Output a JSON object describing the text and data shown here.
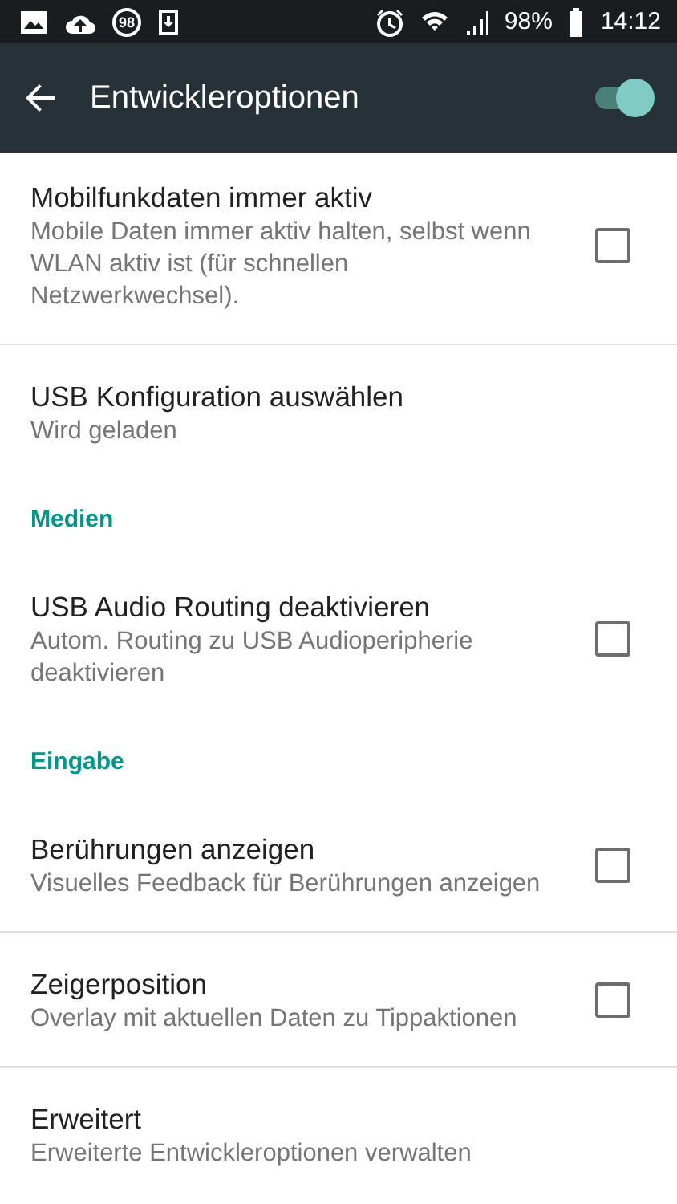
{
  "status_bar": {
    "badge": "98",
    "battery": "98%",
    "time": "14:12"
  },
  "toolbar": {
    "title": "Entwickleroptionen",
    "master_switch": {
      "on": true
    }
  },
  "items": [
    {
      "kind": "checkbox",
      "title": "Mobilfunkdaten immer aktiv",
      "summary": "Mobile Daten immer aktiv halten, selbst wenn WLAN aktiv ist (für schnellen Netzwerkwechsel).",
      "checked": false
    },
    {
      "kind": "plain",
      "title": "USB Konfiguration auswählen",
      "summary": "Wird geladen"
    },
    {
      "kind": "category",
      "title": "Medien"
    },
    {
      "kind": "checkbox",
      "title": "USB Audio Routing deaktivieren",
      "summary": "Autom. Routing zu USB Audioperipherie deaktivieren",
      "checked": false
    },
    {
      "kind": "category",
      "title": "Eingabe"
    },
    {
      "kind": "checkbox",
      "title": "Berührungen anzeigen",
      "summary": "Visuelles Feedback für Berührungen anzeigen",
      "checked": false
    },
    {
      "kind": "checkbox",
      "title": "Zeigerposition",
      "summary": "Overlay mit aktuellen Daten zu Tippaktionen",
      "checked": false
    },
    {
      "kind": "plain",
      "title": "Erweitert",
      "summary": "Erweiterte Entwickleroptionen verwalten"
    }
  ]
}
